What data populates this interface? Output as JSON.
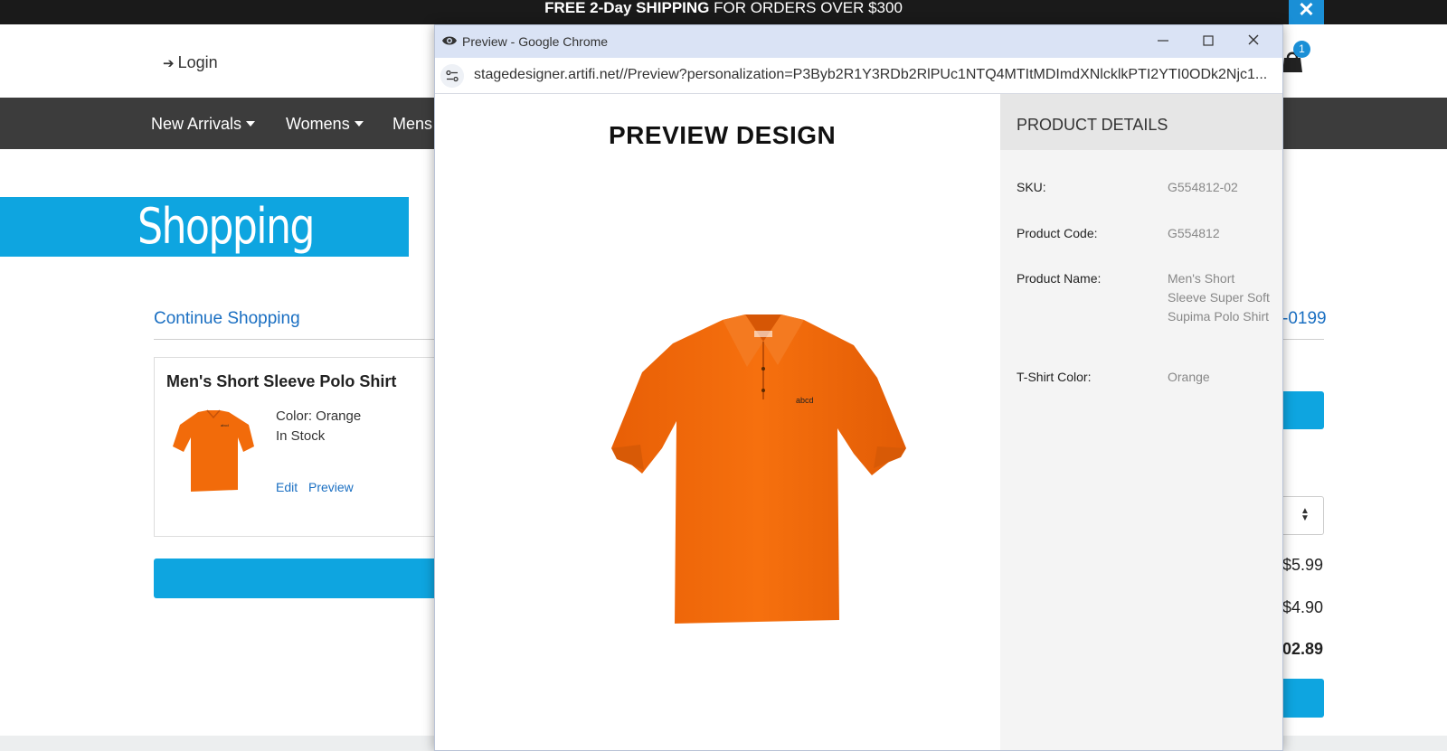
{
  "promo": {
    "bold": "FREE 2-Day SHIPPING",
    "rest": " FOR ORDERS OVER $300",
    "close": "✕"
  },
  "header": {
    "login": "Login",
    "cart_count": "1"
  },
  "nav": {
    "items": [
      {
        "label": "New Arrivals"
      },
      {
        "label": "Womens"
      },
      {
        "label": "Mens"
      }
    ]
  },
  "cart": {
    "title": "Shopping Cart",
    "continue": "Continue Shopping",
    "phone_fragment": "-0199",
    "item": {
      "name": "Men's Short Sleeve Polo Shirt",
      "color": "Color: Orange",
      "stock": "In Stock",
      "edit": "Edit",
      "preview": "Preview"
    },
    "prices": [
      "$5.99",
      "$4.90",
      "02.89"
    ]
  },
  "popup": {
    "window_title": "Preview - Google Chrome",
    "url": "stagedesigner.artifi.net//Preview?personalization=P3Byb2R1Y3RDb2RlPUc1NTQ4MTItMDImdXNlcklkPTI2YTI0ODk2Njc1...",
    "preview_title": "PREVIEW DESIGN",
    "shirt_text": "abcd",
    "details": {
      "title": "PRODUCT DETAILS",
      "rows": [
        {
          "label": "SKU:",
          "value": "G554812-02"
        },
        {
          "label": "Product Code:",
          "value": "G554812"
        },
        {
          "label": "Product Name:",
          "value": "Men's Short Sleeve Super Soft Supima Polo Shirt"
        },
        {
          "label": "T-Shirt Color:",
          "value": "Orange"
        }
      ]
    }
  },
  "colors": {
    "accent_blue": "#0ea5e0",
    "nav_bg": "#3c3c3c",
    "shirt": "#f26b0a"
  }
}
